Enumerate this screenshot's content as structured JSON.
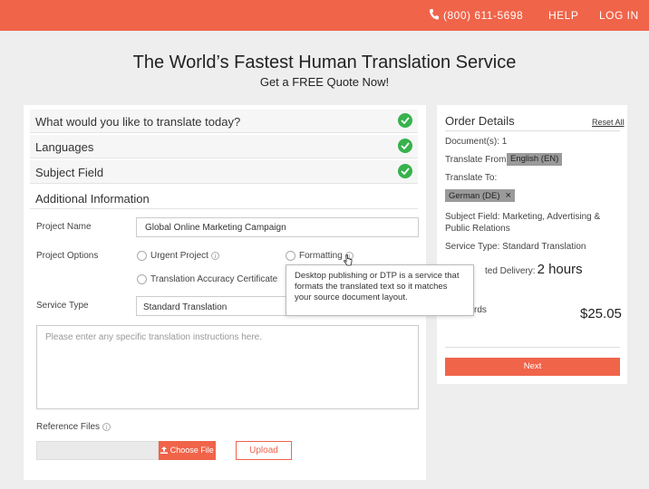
{
  "topbar": {
    "phone_icon": "phone-icon",
    "phone": "(800) 611-5698",
    "help": "HELP",
    "login": "LOG IN",
    "color": "#f0644a"
  },
  "hero": {
    "title": "The World’s Fastest Human Translation Service",
    "subtitle": "Get a FREE Quote Now!"
  },
  "steps": [
    {
      "label": "What would you like to translate today?",
      "complete": true
    },
    {
      "label": "Languages",
      "complete": true
    },
    {
      "label": "Subject Field",
      "complete": true
    },
    {
      "label": "Additional Information",
      "complete": false
    }
  ],
  "form": {
    "project_name_label": "Project Name",
    "project_name_value": "Global Online Marketing Campaign",
    "project_options_label": "Project Options",
    "options": [
      "Urgent Project",
      "Formatting",
      "Translation Accuracy Certificate"
    ],
    "service_type_label": "Service Type",
    "service_type_value": "Standard Translation",
    "instructions_placeholder": "Please enter any specific translation instructions here.",
    "reference_files_label": "Reference Files",
    "choose_file": "Choose File",
    "upload": "Upload"
  },
  "tooltip": {
    "text": "Desktop publishing or DTP is a service that formats the translated text so it matches your source document layout."
  },
  "order": {
    "title": "Order Details",
    "reset": "Reset All",
    "documents": "Document(s): 1",
    "translate_from_label": "Translate From:",
    "translate_from_value": "English (EN)",
    "translate_to_label": "Translate To:",
    "translate_to_value": "German (DE)",
    "subject_field": "Subject Field: Marketing, Advertising & Public Relations",
    "service_type": "Service Type:  Standard Translation",
    "delivery_label": "ted Delivery:",
    "delivery_value": "2 hours",
    "words_label": "rds",
    "price": "$25.05",
    "next": "Next"
  }
}
